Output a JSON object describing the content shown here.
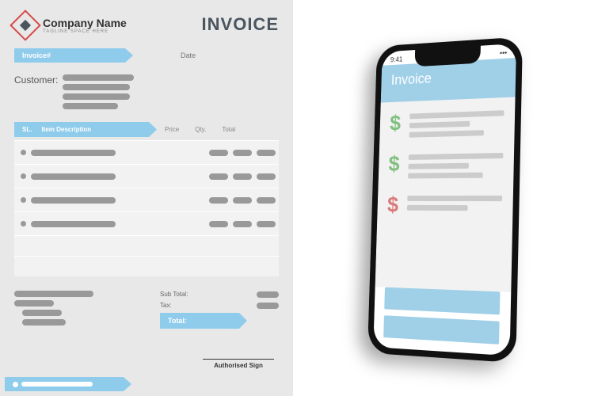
{
  "document": {
    "company_name": "Company Name",
    "tagline": "TAGLINE SPACE HERE",
    "title": "INVOICE",
    "invoice_number_label": "Invoice#",
    "date_label": "Date",
    "customer_label": "Customer:",
    "table_headers": {
      "sl": "SL.",
      "desc": "Item Description",
      "price": "Price",
      "qty": "Qty.",
      "total": "Total"
    },
    "totals": {
      "subtotal_label": "Sub Total:",
      "tax_label": "Tax:",
      "total_label": "Total:"
    },
    "sign_label": "Authorised Sign"
  },
  "phone": {
    "time": "9:41",
    "header": "Invoice"
  }
}
